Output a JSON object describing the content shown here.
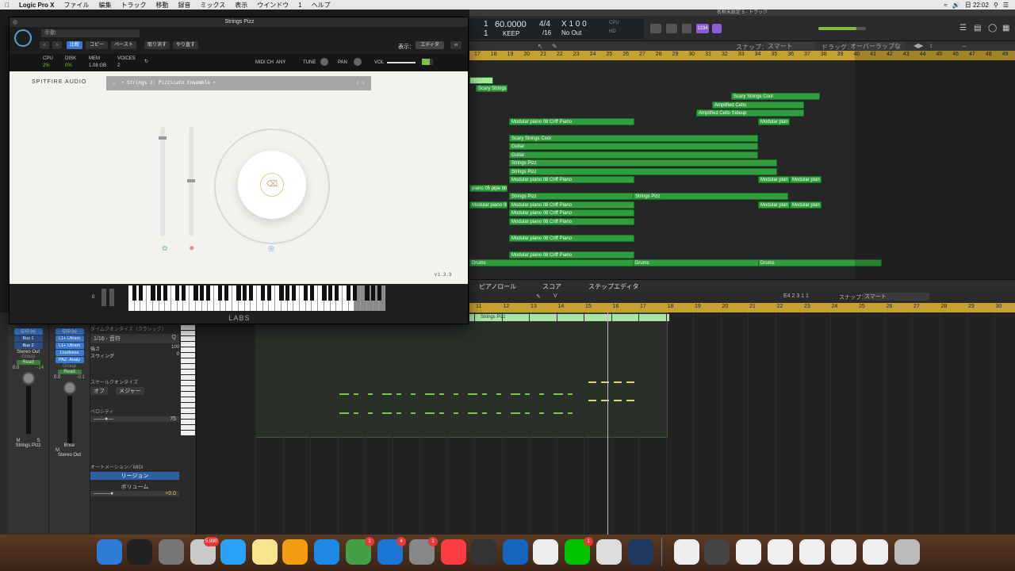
{
  "menubar": {
    "app": "Logic Pro X",
    "items": [
      "ファイル",
      "編集",
      "トラック",
      "移動",
      "録音",
      "ミックス",
      "表示",
      "ウインドウ",
      "1",
      "ヘルプ"
    ],
    "clock": "日 22:02"
  },
  "window_title": "名称未設定 5 - トラック",
  "lcd": {
    "bar": "1",
    "beat": "1",
    "tempo": "60.0000",
    "keep": "KEEP",
    "signature": "4/4",
    "division": "/16",
    "key": "X 1 0 0",
    "no_out": "No Out",
    "cpu": "CPU",
    "hd": "HD",
    "track_badge": "1234"
  },
  "tracks_toolbar": {
    "snap_label": "スナップ：",
    "snap_value": "スマート",
    "drag_label": "ドラッグ：",
    "drag_value": "オーバーラップなし"
  },
  "ruler_bars": [
    "17",
    "18",
    "19",
    "20",
    "21",
    "22",
    "23",
    "24",
    "25",
    "26",
    "27",
    "28",
    "29",
    "30",
    "31",
    "32",
    "33",
    "34",
    "35",
    "36",
    "37",
    "38",
    "39",
    "40",
    "41",
    "42",
    "43",
    "44",
    "45",
    "46",
    "47",
    "48",
    "49",
    "50"
  ],
  "regions": [
    {
      "label": "",
      "row": 0
    },
    {
      "label": "Scary Strings",
      "row": 1
    },
    {
      "label": "Scary Strings Cool",
      "row": 2
    },
    {
      "label": "Amplified Cello",
      "row": 3
    },
    {
      "label": "Amplified Cello Sideup",
      "row": 4
    },
    {
      "label": "Modular piano 08 Criff Piano",
      "row": 5
    },
    {
      "label": "Modular plan",
      "row": 5
    },
    {
      "label": "Scary Strings Cool",
      "row": 7
    },
    {
      "label": "Guitar",
      "row": 8
    },
    {
      "label": "Guitar",
      "row": 9
    },
    {
      "label": "Strings Pizz",
      "row": 10
    },
    {
      "label": "Strings Pizz",
      "row": 11
    },
    {
      "label": "Modular piano 08 Criff Piano",
      "row": 12
    },
    {
      "label": "Modular plan",
      "row": 12
    },
    {
      "label": "Modular plan",
      "row": 12
    },
    {
      "label": "piano 05 pipe bbom",
      "row": 13
    },
    {
      "label": "Strings Pizz",
      "row": 14
    },
    {
      "label": "Strings Pizz",
      "row": 14
    },
    {
      "label": "Modular piano 08 Criff",
      "row": 15
    },
    {
      "label": "Modular piano 08 Criff Piano",
      "row": 15
    },
    {
      "label": "Modular plan",
      "row": 15
    },
    {
      "label": "Modular plan",
      "row": 15
    },
    {
      "label": "Modular piano 08 Criff Piano",
      "row": 16
    },
    {
      "label": "Modular piano 08 Criff Piano",
      "row": 17
    },
    {
      "label": "Modular piano 08 Criff Piano",
      "row": 19
    },
    {
      "label": "Modular piano 08 Criff Piano",
      "row": 21
    },
    {
      "label": "Drums",
      "row": 22
    },
    {
      "label": "Drums",
      "row": 22
    },
    {
      "label": "Drums",
      "row": 22
    }
  ],
  "editor_tabs": [
    "ピアノロール",
    "スコア",
    "ステップエディタ"
  ],
  "editor_tools": {
    "position": "E4  2 3 1 1",
    "snap_label": "スナップ：",
    "snap_value": "スマート"
  },
  "editor_ruler": [
    "11",
    "12",
    "13",
    "14",
    "15",
    "16",
    "17",
    "18",
    "19",
    "20",
    "21",
    "22",
    "23",
    "24",
    "25",
    "26",
    "27",
    "28",
    "29",
    "30"
  ],
  "editor_region": "Strings Pizz",
  "inspector": {
    "time_quantize": "タイムクオンタイズ（クラシック）",
    "quantize_value": "1/16 - 音符",
    "strength_label": "強さ",
    "strength_value": "100",
    "swing_label": "スウィング",
    "swing_value": "0",
    "scale_quantize": "スケールクオンタイズ",
    "scale_off": "オフ",
    "scale_major": "メジャー",
    "velocity_label": "ベロシティ",
    "velocity_value": "75",
    "automation": "オートメーション／MIDI",
    "region_btn": "リージョン",
    "volume_label": "ボリューム",
    "volume_value": "+0.0",
    "plugins": [
      "Q10 (s)",
      "L1+ Ultram",
      "L1+ Ultram",
      "Loudness",
      "PAZ- Analy"
    ],
    "bus1": "Bus 1",
    "bus2": "Bus 2",
    "stereo_out": "Stereo Out",
    "group": "Group",
    "read": "Read",
    "strip1": {
      "name": "Strings Pizz",
      "vol": "0.0",
      "peak": "-14"
    },
    "strip2": {
      "name": "Stereo Out",
      "vol": "0.0",
      "peak": "-0.1",
      "bnce": "Bnce"
    },
    "m": "M",
    "s": "S"
  },
  "plugin": {
    "title": "Strings Pizz",
    "preset_menu": "手動",
    "compare": "比較",
    "copy": "コピー",
    "paste": "ペースト",
    "undo": "取り消す",
    "redo": "やり直す",
    "view_label": "表示：",
    "view_value": "エディタ",
    "cpu_label": "CPU",
    "cpu_value": "2%",
    "disk_label": "DISK",
    "disk_value": "0%",
    "mem_label": "MEM",
    "mem_value": "1.08 GB",
    "voices_label": "VOICES",
    "voices_value": "2",
    "midi_label": "MIDI CH",
    "midi_value": "ANY",
    "tune": "TUNE",
    "pan": "PAN",
    "vol": "VOL",
    "brand": "SPITFIRE AUDIO",
    "patch": "• Strings 2: Pizzicato Ensemble •",
    "version": "v1.3.3",
    "labs": "LABS",
    "octave": "0"
  },
  "dock": {
    "badges": {
      "photos": "5,990",
      "messages": "1",
      "appstore": "4",
      "prefs": "1",
      "line": "1"
    }
  }
}
